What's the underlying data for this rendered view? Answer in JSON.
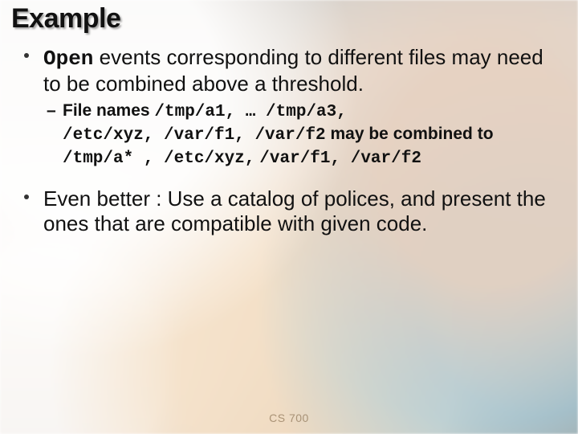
{
  "title": "Example",
  "bullet1_pre_mono": "Open",
  "bullet1_post": " events corresponding to different files may need to be combined above a threshold.",
  "level2": {
    "lead": "File names ",
    "seg1": "/tmp/a1, … /tmp/a3,",
    "seg2": "/etc/xyz, /var/f1, /var/f2",
    "mid": " may be combined to ",
    "seg3": "/tmp/a* , /etc/xyz,",
    "seg4": "/var/f1, /var/f2"
  },
  "bullet2": "Even better : Use a catalog of polices, and present the ones that are compatible with given code.",
  "footer": "CS 700",
  "chart_data": null
}
